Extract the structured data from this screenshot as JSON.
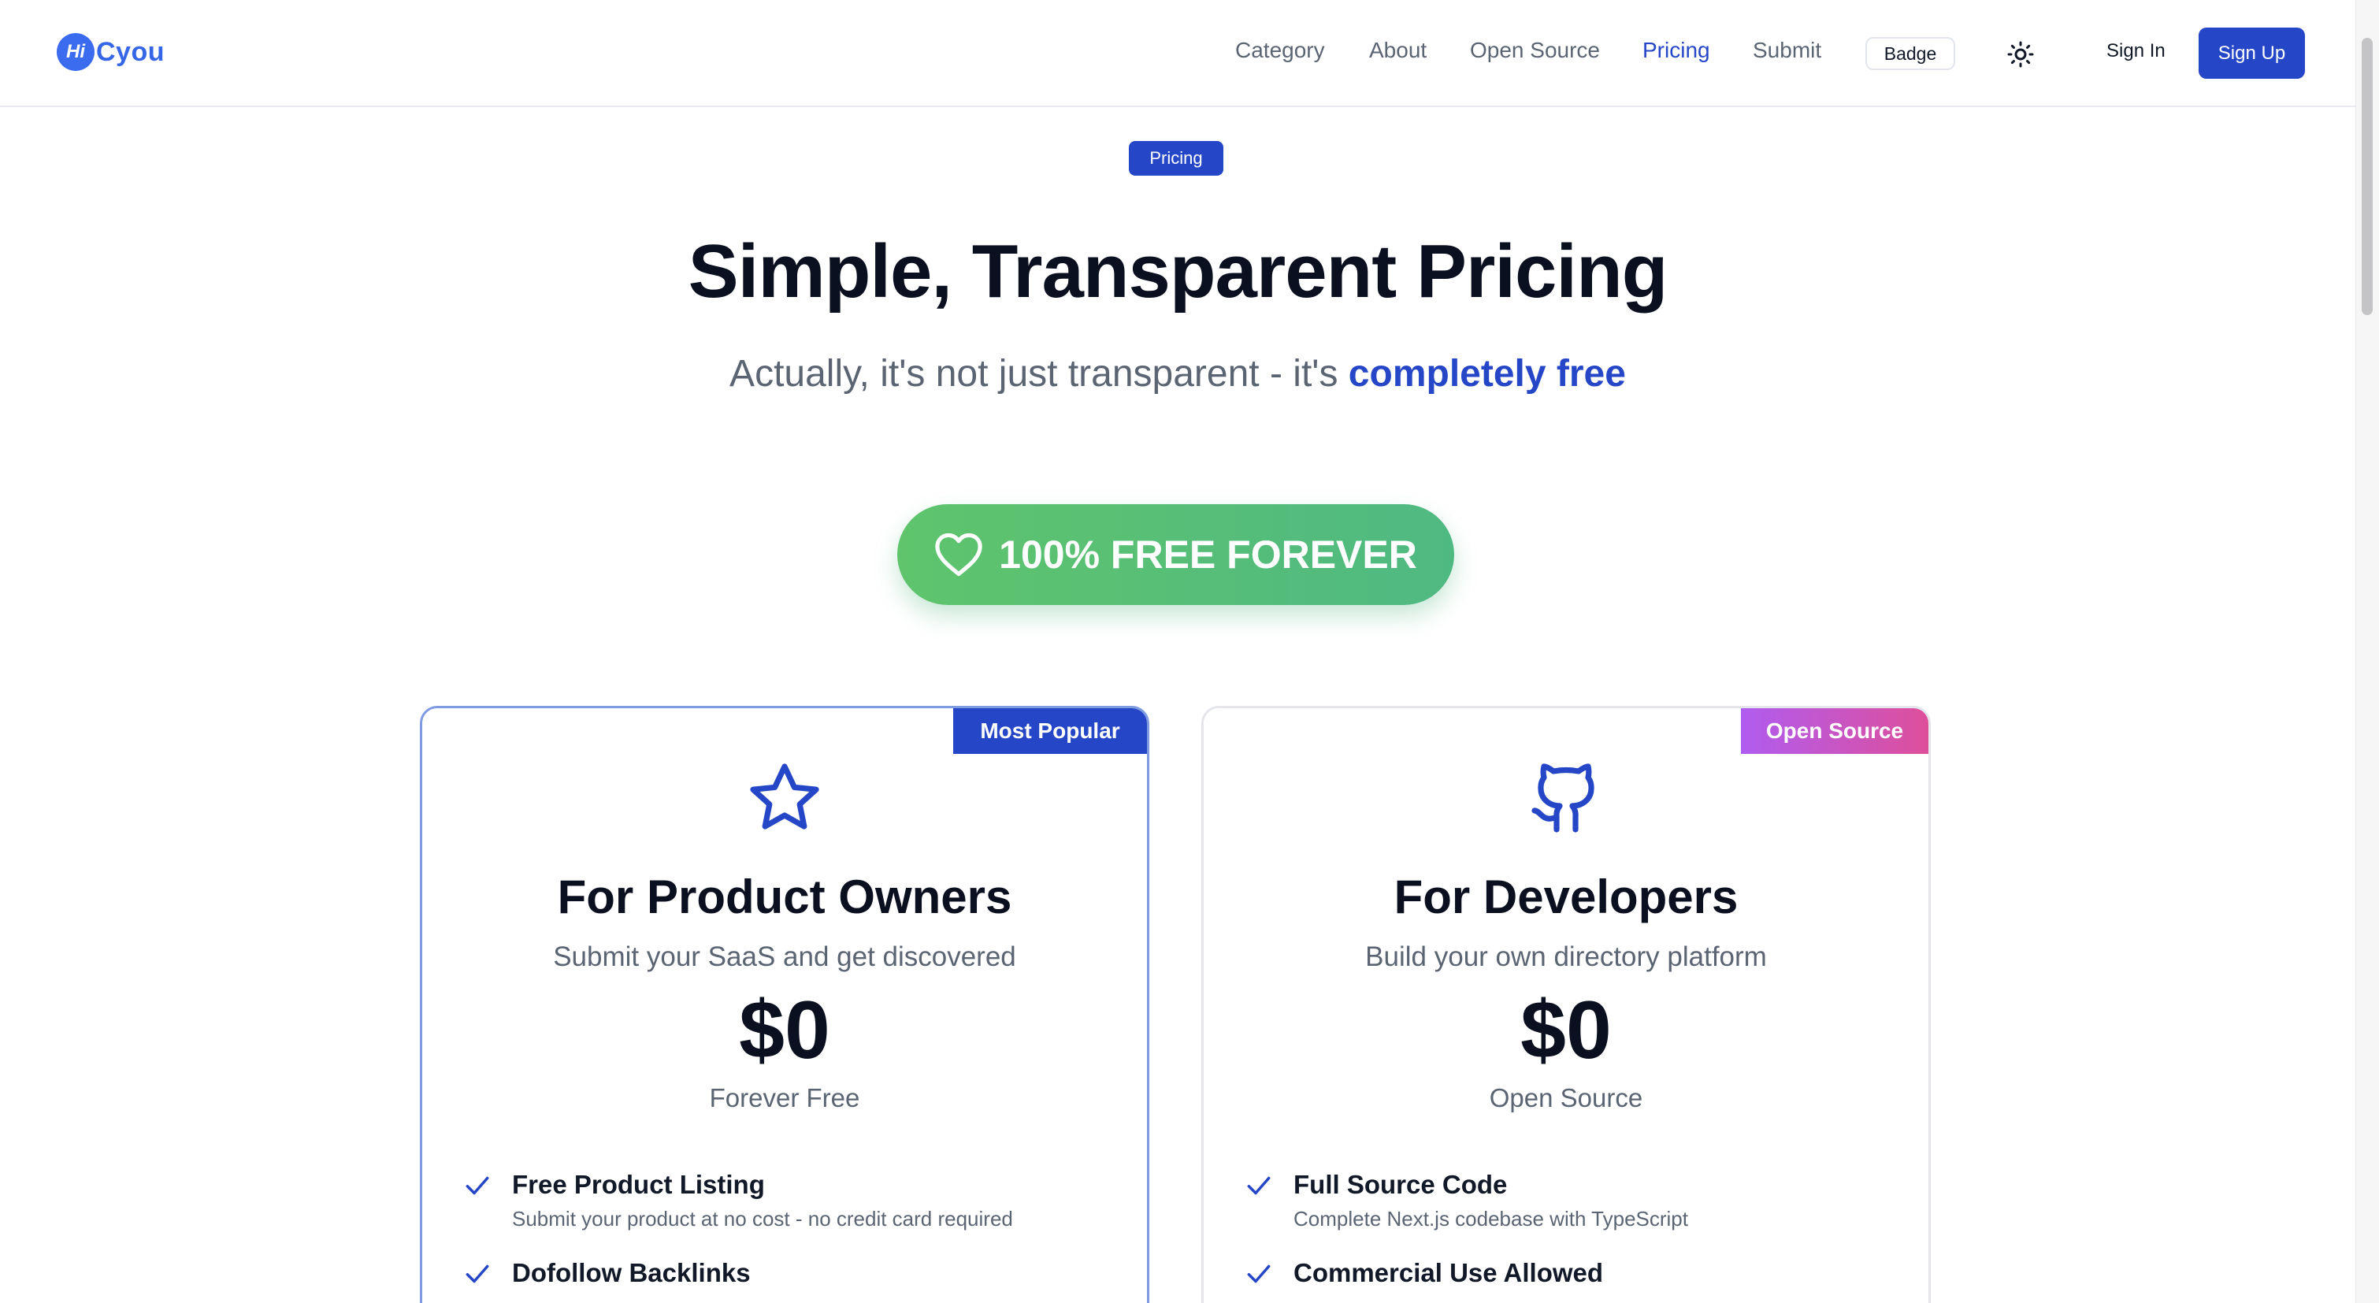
{
  "header": {
    "logo_mark": "Hi",
    "logo_text": "Cyou",
    "nav": [
      {
        "label": "Category",
        "active": false
      },
      {
        "label": "About",
        "active": false
      },
      {
        "label": "Open Source",
        "active": false
      },
      {
        "label": "Pricing",
        "active": true
      },
      {
        "label": "Submit",
        "active": false
      }
    ],
    "badge_label": "Badge",
    "theme_toggle_icon": "sun-icon",
    "sign_in_label": "Sign In",
    "sign_up_label": "Sign Up"
  },
  "hero": {
    "pill_label": "Pricing",
    "title": "Simple, Transparent Pricing",
    "subtitle_prefix": "Actually, it's not just transparent - it's ",
    "subtitle_highlight": "completely free",
    "free_button_label": "100% FREE FOREVER",
    "free_button_icon": "heart-icon"
  },
  "plans": [
    {
      "corner_label": "Most Popular",
      "icon": "star-icon",
      "title": "For Product Owners",
      "subtitle": "Submit your SaaS and get discovered",
      "price": "$0",
      "price_note": "Forever Free",
      "features": [
        {
          "title": "Free Product Listing",
          "desc": "Submit your product at no cost - no credit card required"
        },
        {
          "title": "Dofollow Backlinks",
          "desc": ""
        }
      ]
    },
    {
      "corner_label": "Open Source",
      "icon": "github-icon",
      "title": "For Developers",
      "subtitle": "Build your own directory platform",
      "price": "$0",
      "price_note": "Open Source",
      "features": [
        {
          "title": "Full Source Code",
          "desc": "Complete Next.js codebase with TypeScript"
        },
        {
          "title": "Commercial Use Allowed",
          "desc": ""
        }
      ]
    }
  ],
  "colors": {
    "primary": "#2547c7",
    "logo_blue": "#3b6cf0",
    "muted_text": "#5b6472",
    "free_green_start": "#5fc46c",
    "free_green_end": "#4fb982",
    "open_source_gradient_start": "#b05cf0",
    "open_source_gradient_end": "#de4f9a"
  }
}
